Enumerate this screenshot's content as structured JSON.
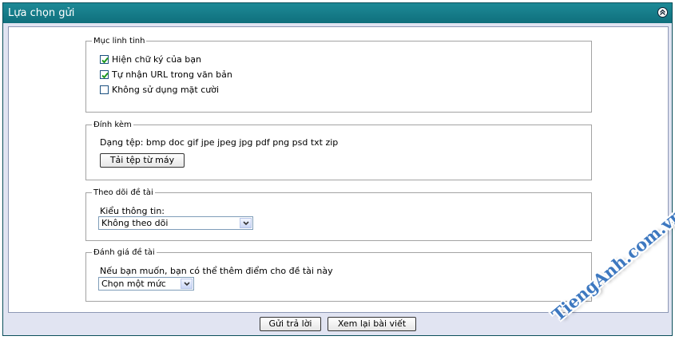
{
  "window": {
    "title": "Lựa chọn gửi"
  },
  "misc": {
    "legend": "Mục linh tinh",
    "options": [
      {
        "label": "Hiện chữ ký của bạn",
        "checked": true
      },
      {
        "label": "Tự nhận URL trong văn bản",
        "checked": true
      },
      {
        "label": "Không sử dụng mặt cười",
        "checked": false
      }
    ]
  },
  "attach": {
    "legend": "Đính kèm",
    "types_text": "Dạng tệp: bmp doc gif jpe jpeg jpg pdf png psd txt zip",
    "upload_label": "Tải tệp từ máy"
  },
  "subscribe": {
    "legend": "Theo dõi đề tài",
    "label": "Kiểu thông tin:",
    "selected": "Không theo dõi"
  },
  "rating": {
    "legend": "Đánh giá đề tài",
    "label": "Nếu bạn muốn, bạn có thể thêm điểm cho đề tài này",
    "selected": "Chọn một mức"
  },
  "footer": {
    "submit_label": "Gửi trả lời",
    "preview_label": "Xem lại bài viết"
  },
  "watermark": {
    "text": "TiengAnh.com.vn"
  },
  "icons": {
    "collapse": "collapse-up-icon",
    "check": "check-icon",
    "dropdown": "chevron-down-icon"
  },
  "colors": {
    "titlebar": "#1a8391",
    "panel_bg": "#e1e4f2",
    "watermark": "#3d78c0"
  }
}
